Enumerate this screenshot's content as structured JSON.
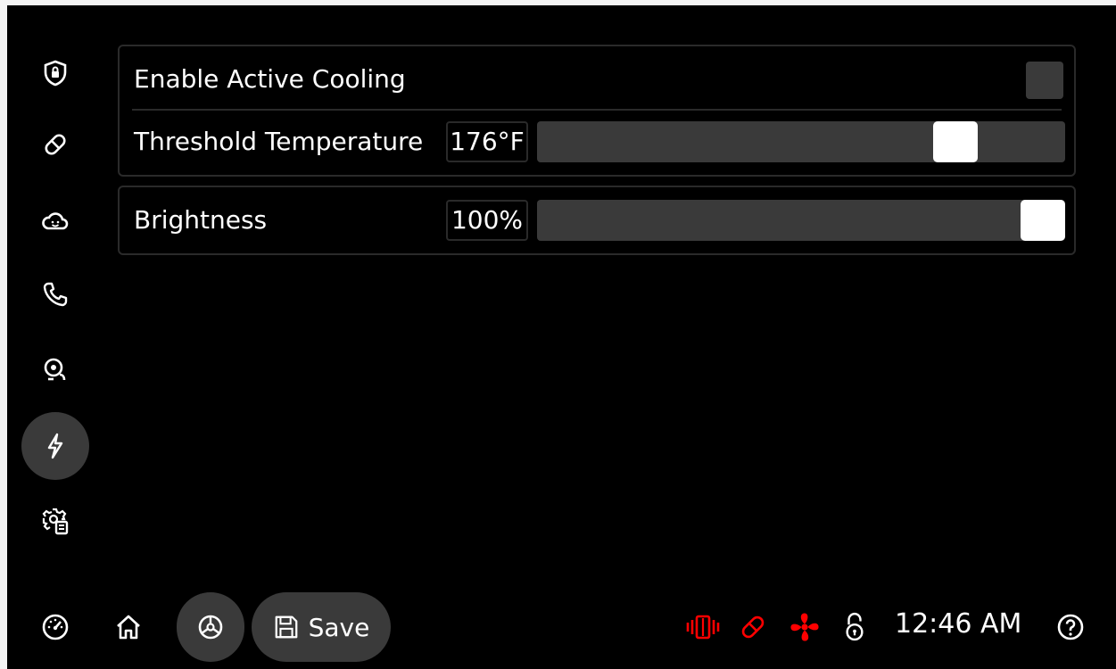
{
  "sidebar": {
    "items": [
      {
        "icon": "shield-lock-icon",
        "active": false
      },
      {
        "icon": "pill-icon",
        "active": false
      },
      {
        "icon": "cloud-smile-icon",
        "active": false
      },
      {
        "icon": "phone-icon",
        "active": false
      },
      {
        "icon": "alarm-bell-icon",
        "active": false
      },
      {
        "icon": "lightning-icon",
        "active": true
      },
      {
        "icon": "settings-document-icon",
        "active": false
      }
    ]
  },
  "panels": {
    "cooling": {
      "enable_label": "Enable Active Cooling",
      "enable_checked": false,
      "threshold_label": "Threshold Temperature",
      "threshold_value": "176°F",
      "threshold_fraction": 0.82
    },
    "brightness": {
      "label": "Brightness",
      "value": "100%",
      "fraction": 1.0
    }
  },
  "bottom_bar": {
    "save_label": "Save",
    "clock": "12:46 AM",
    "status_icons": [
      "vibrate-icon",
      "pill-icon",
      "fan-icon",
      "unlocked-icon"
    ],
    "alert_color": "#ff0000"
  }
}
